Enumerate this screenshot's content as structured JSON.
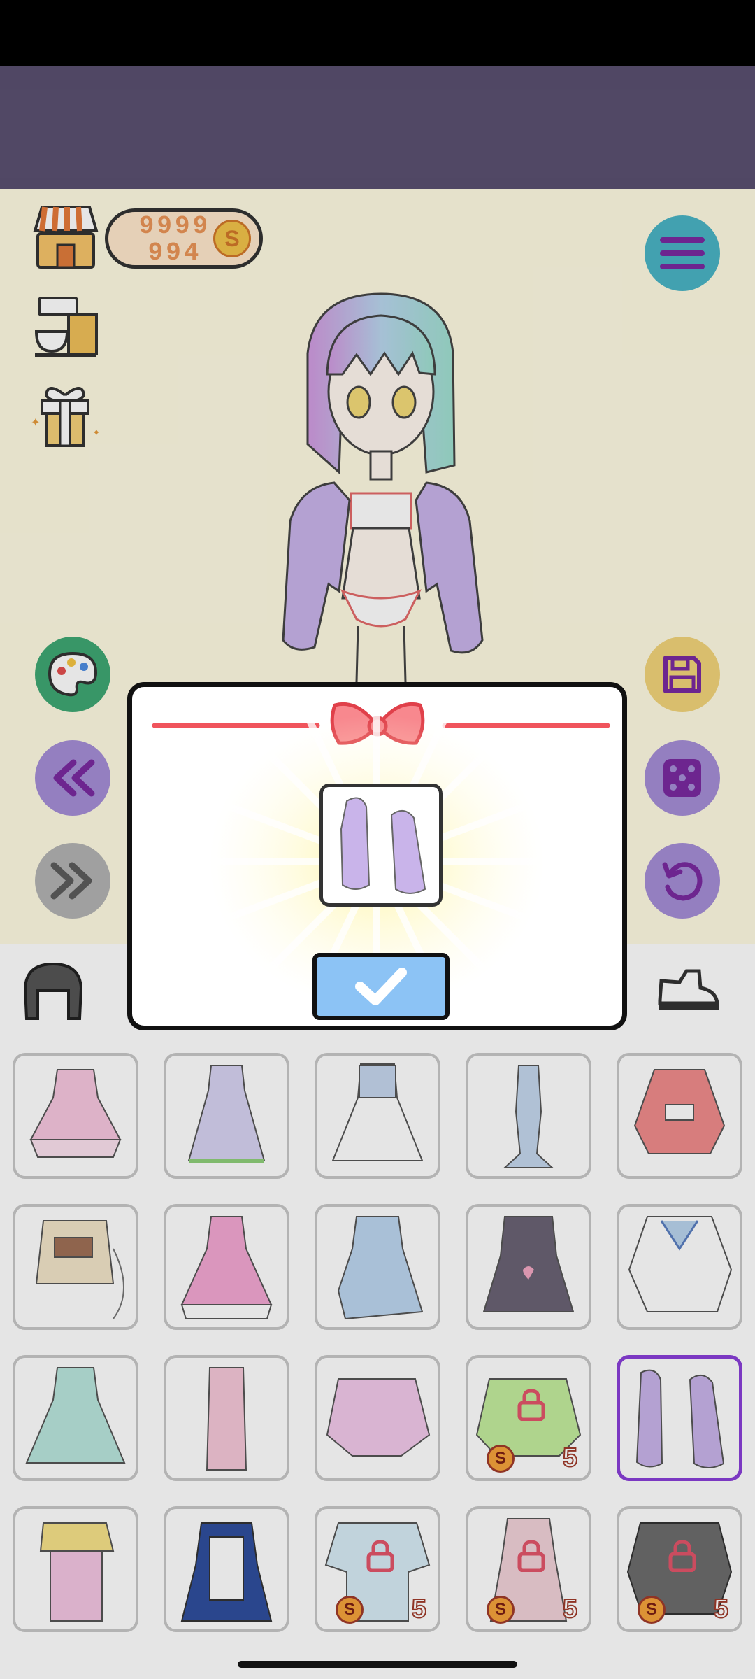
{
  "coins": {
    "line1": "9999",
    "line2": "994",
    "symbol": "S"
  },
  "colors": {
    "accent_purple": "#8a3fd8",
    "dialog_ribbon": "#f0545c",
    "confirm": "#8cc3f5"
  },
  "left_buttons": [
    "shop-icon",
    "coffee-machine-icon",
    "gift-icon",
    "palette-icon",
    "rewind-icon",
    "fast-forward-icon"
  ],
  "right_buttons": [
    "menu-icon",
    "save-icon",
    "dice-icon",
    "undo-icon"
  ],
  "tabs": [
    "hair-icon",
    "shoe-icon"
  ],
  "locked_prices": [
    {
      "symbol": "S",
      "amount": "5"
    },
    {
      "symbol": "S",
      "amount": "5"
    },
    {
      "symbol": "S",
      "amount": "5"
    },
    {
      "symbol": "S",
      "amount": "5"
    }
  ],
  "dialog": {
    "item": "purple-jacket",
    "confirm_icon": "checkmark-icon"
  }
}
